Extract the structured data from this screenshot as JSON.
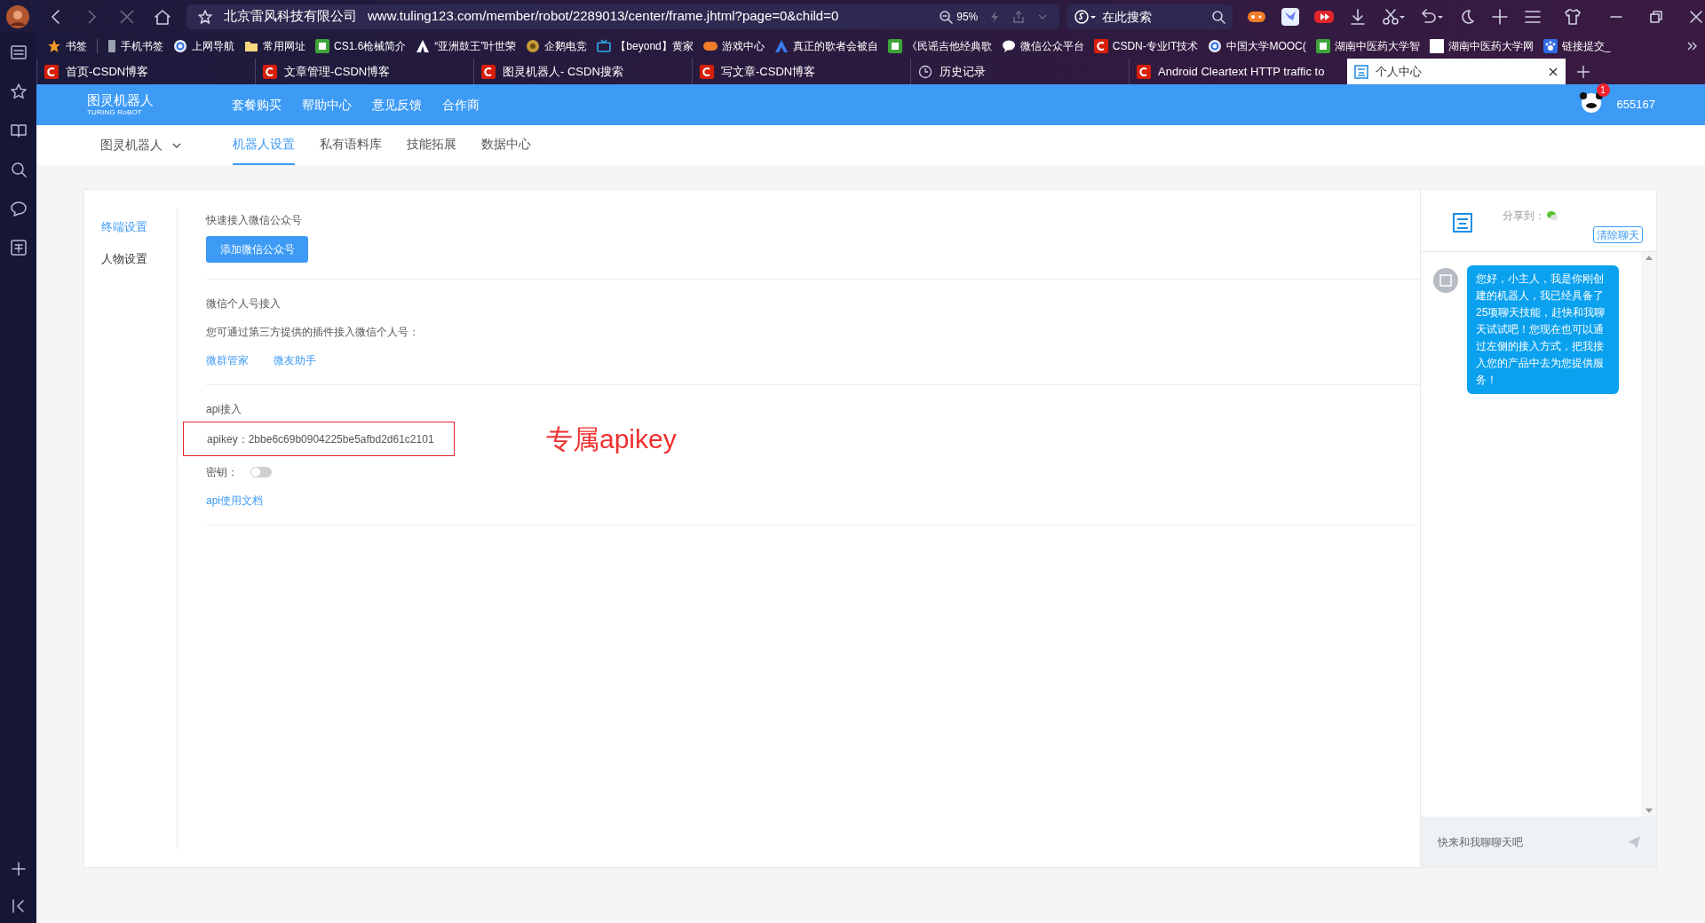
{
  "browser": {
    "site_name": "北京雷风科技有限公司",
    "url": "www.tuling123.com/member/robot/2289013/center/frame.jhtml?page=0&child=0",
    "zoom": "95%",
    "search": {
      "placeholder": "在此搜索"
    }
  },
  "bookmarks": [
    {
      "label": "书签",
      "kind": "star"
    },
    {
      "label": "手机书签",
      "kind": "phone"
    },
    {
      "label": "上网导航",
      "kind": "globe"
    },
    {
      "label": "常用网址",
      "kind": "folder"
    },
    {
      "label": "CS1.6枪械简介",
      "kind": "app"
    },
    {
      "label": "“亚洲鼓王”叶世荣",
      "kind": "tent"
    },
    {
      "label": "企鹅电竞",
      "kind": "badge"
    },
    {
      "label": "【beyond】黄家",
      "kind": "tv"
    },
    {
      "label": "游戏中心",
      "kind": "game"
    },
    {
      "label": "真正的歌者会被自",
      "kind": "person"
    },
    {
      "label": "《民谣吉他经典歌",
      "kind": "app"
    },
    {
      "label": "微信公众平台",
      "kind": "chat"
    },
    {
      "label": "CSDN-专业IT技术",
      "kind": "csdn"
    },
    {
      "label": "中国大学MOOC(",
      "kind": "globe"
    },
    {
      "label": "湖南中医药大学智",
      "kind": "app"
    },
    {
      "label": "湖南中医药大学网",
      "kind": "page"
    },
    {
      "label": "链接提交_",
      "kind": "paw"
    }
  ],
  "tabs": [
    {
      "label": "首页-CSDN博客",
      "kind": "csdn",
      "selected": false
    },
    {
      "label": "文章管理-CSDN博客",
      "kind": "csdn",
      "selected": false
    },
    {
      "label": "图灵机器人- CSDN搜索",
      "kind": "csdn",
      "selected": false
    },
    {
      "label": "写文章-CSDN博客",
      "kind": "csdn",
      "selected": false
    },
    {
      "label": "历史记录",
      "kind": "history",
      "selected": false
    },
    {
      "label": "Android Cleartext HTTP traffic to",
      "kind": "csdn",
      "selected": false
    },
    {
      "label": "个人中心",
      "kind": "site",
      "selected": true
    }
  ],
  "header": {
    "logo": {
      "title": "图灵机器人",
      "subtitle": "TURING RoBOT"
    },
    "nav": [
      "套餐购买",
      "帮助中心",
      "意见反馈",
      "合作商"
    ],
    "user": {
      "badge": "1",
      "name": "655167"
    }
  },
  "subnav": {
    "robot": "图灵机器人",
    "tabs": [
      {
        "label": "机器人设置",
        "selected": true
      },
      {
        "label": "私有语料库",
        "selected": false
      },
      {
        "label": "技能拓展",
        "selected": false
      },
      {
        "label": "数据中心",
        "selected": false
      }
    ]
  },
  "side_menu": [
    {
      "label": "终端设置",
      "selected": true
    },
    {
      "label": "人物设置",
      "selected": false
    }
  ],
  "sections": [
    {
      "kind": "button",
      "title": "快速接入微信公众号",
      "button": "添加微信公众号"
    },
    {
      "kind": "links",
      "title": "微信个人号接入",
      "text": "您可通过第三方提供的插件接入微信个人号：",
      "links": [
        "微群管家",
        "微友助手"
      ]
    },
    {
      "kind": "api",
      "title": "api接入",
      "apikey": "apikey：2bbe6c69b0904225be5afbd2d61c2101",
      "annotation": "专属apikey",
      "secret": {
        "label": "密钥：",
        "on": false
      },
      "link": "api使用文档"
    }
  ],
  "chat": {
    "share_label": "分享到：",
    "clear": "清除聊天",
    "messages": [
      {
        "text": "您好，小主人，我是你刚创建的机器人，我已经具备了25项聊天技能，赶快和我聊天试试吧！您现在也可以通过左侧的接入方式，把我接入您的产品中去为您提供服务！"
      }
    ],
    "input": {
      "placeholder": "快来和我聊聊天吧"
    }
  }
}
